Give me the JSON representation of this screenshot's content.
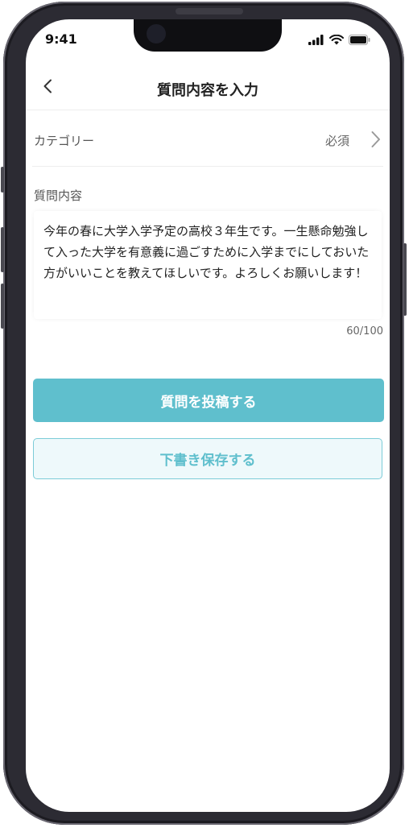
{
  "status_bar": {
    "time": "9:41"
  },
  "nav": {
    "back_icon": "chevron-left-icon",
    "title": "質問内容を入力"
  },
  "category": {
    "label": "カテゴリー",
    "required": "必須",
    "icon": "chevron-right-icon"
  },
  "question": {
    "section_label": "質問内容",
    "text": "今年の春に大学入学予定の高校３年生です。一生懸命勉強して入った大学を有意義に過ごすために入学までにしておいた方がいいことを教えてほしいです。よろしくお願いします！",
    "char_count": "60/100"
  },
  "actions": {
    "submit_label": "質問を投稿する",
    "draft_label": "下書き保存する"
  },
  "colors": {
    "accent": "#5fbfcd",
    "draft_bg": "#eef9fb",
    "draft_border": "#7cccd8"
  }
}
